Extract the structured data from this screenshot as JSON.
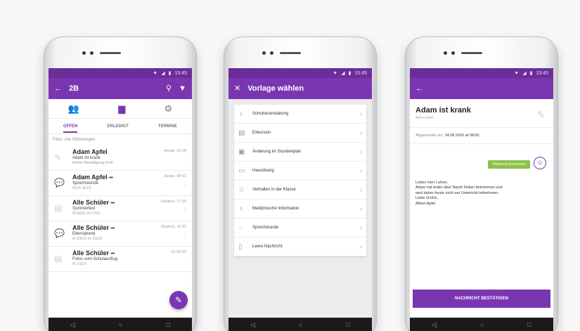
{
  "status_time": "15:45",
  "phone1": {
    "title": "2B",
    "tabs": [
      "OFFEN",
      "ERLEDIGT",
      "TERMINE"
    ],
    "filter": "Filter: Alle Mitteilungen",
    "messages": [
      {
        "title": "Adam Apfel",
        "subtitle": "Adam ist krank",
        "meta": "Meine Bestätigung fehlt",
        "time": "Heute, 10:28"
      },
      {
        "title": "Adam Apfel",
        "subtitle": "Sprechstunde",
        "meta": "✉1/1  ⁂1/1",
        "time": "Heute, 08:13"
      },
      {
        "title": "Alle Schüler",
        "subtitle": "Sommerfest",
        "meta": "✉19/23  ⁂17/23",
        "time": "Gestern, 17:30"
      },
      {
        "title": "Alle Schüler",
        "subtitle": "Elternabend",
        "meta": "✉ 23/23 ⁂ 21/23",
        "time": "Gestern, 11:07"
      },
      {
        "title": "Alle Schüler",
        "subtitle": "Fotos vom Schulausflug",
        "meta": "✉ 23/23",
        "time": "01.09.20"
      }
    ]
  },
  "phone2": {
    "title": "Vorlage wählen",
    "templates": [
      "Schulveranstaltung",
      "Exkursion",
      "Änderung im Stundenplan",
      "Hausübung",
      "Verhalten in der Klasse",
      "Medizinische Information",
      "Sprechstunde",
      "Leere Nachricht"
    ]
  },
  "phone3": {
    "title": "Adam ist krank",
    "author": "Albert Apfel",
    "sent_label": "Abgesendet am:",
    "sent_value": "14.08.2016 at 08:00",
    "bubble": "Mitteilung übersetzen",
    "body": [
      "Lieber Herr Lehrer,",
      "Adam hat leider über Nacht Fieber bekommen und",
      "wird daher heute nicht am Unterricht teilnehmen.",
      "Liebe Grüße,",
      "Albert Apfel"
    ],
    "confirm": "NACHRICHT BESTÄTIGEN"
  }
}
